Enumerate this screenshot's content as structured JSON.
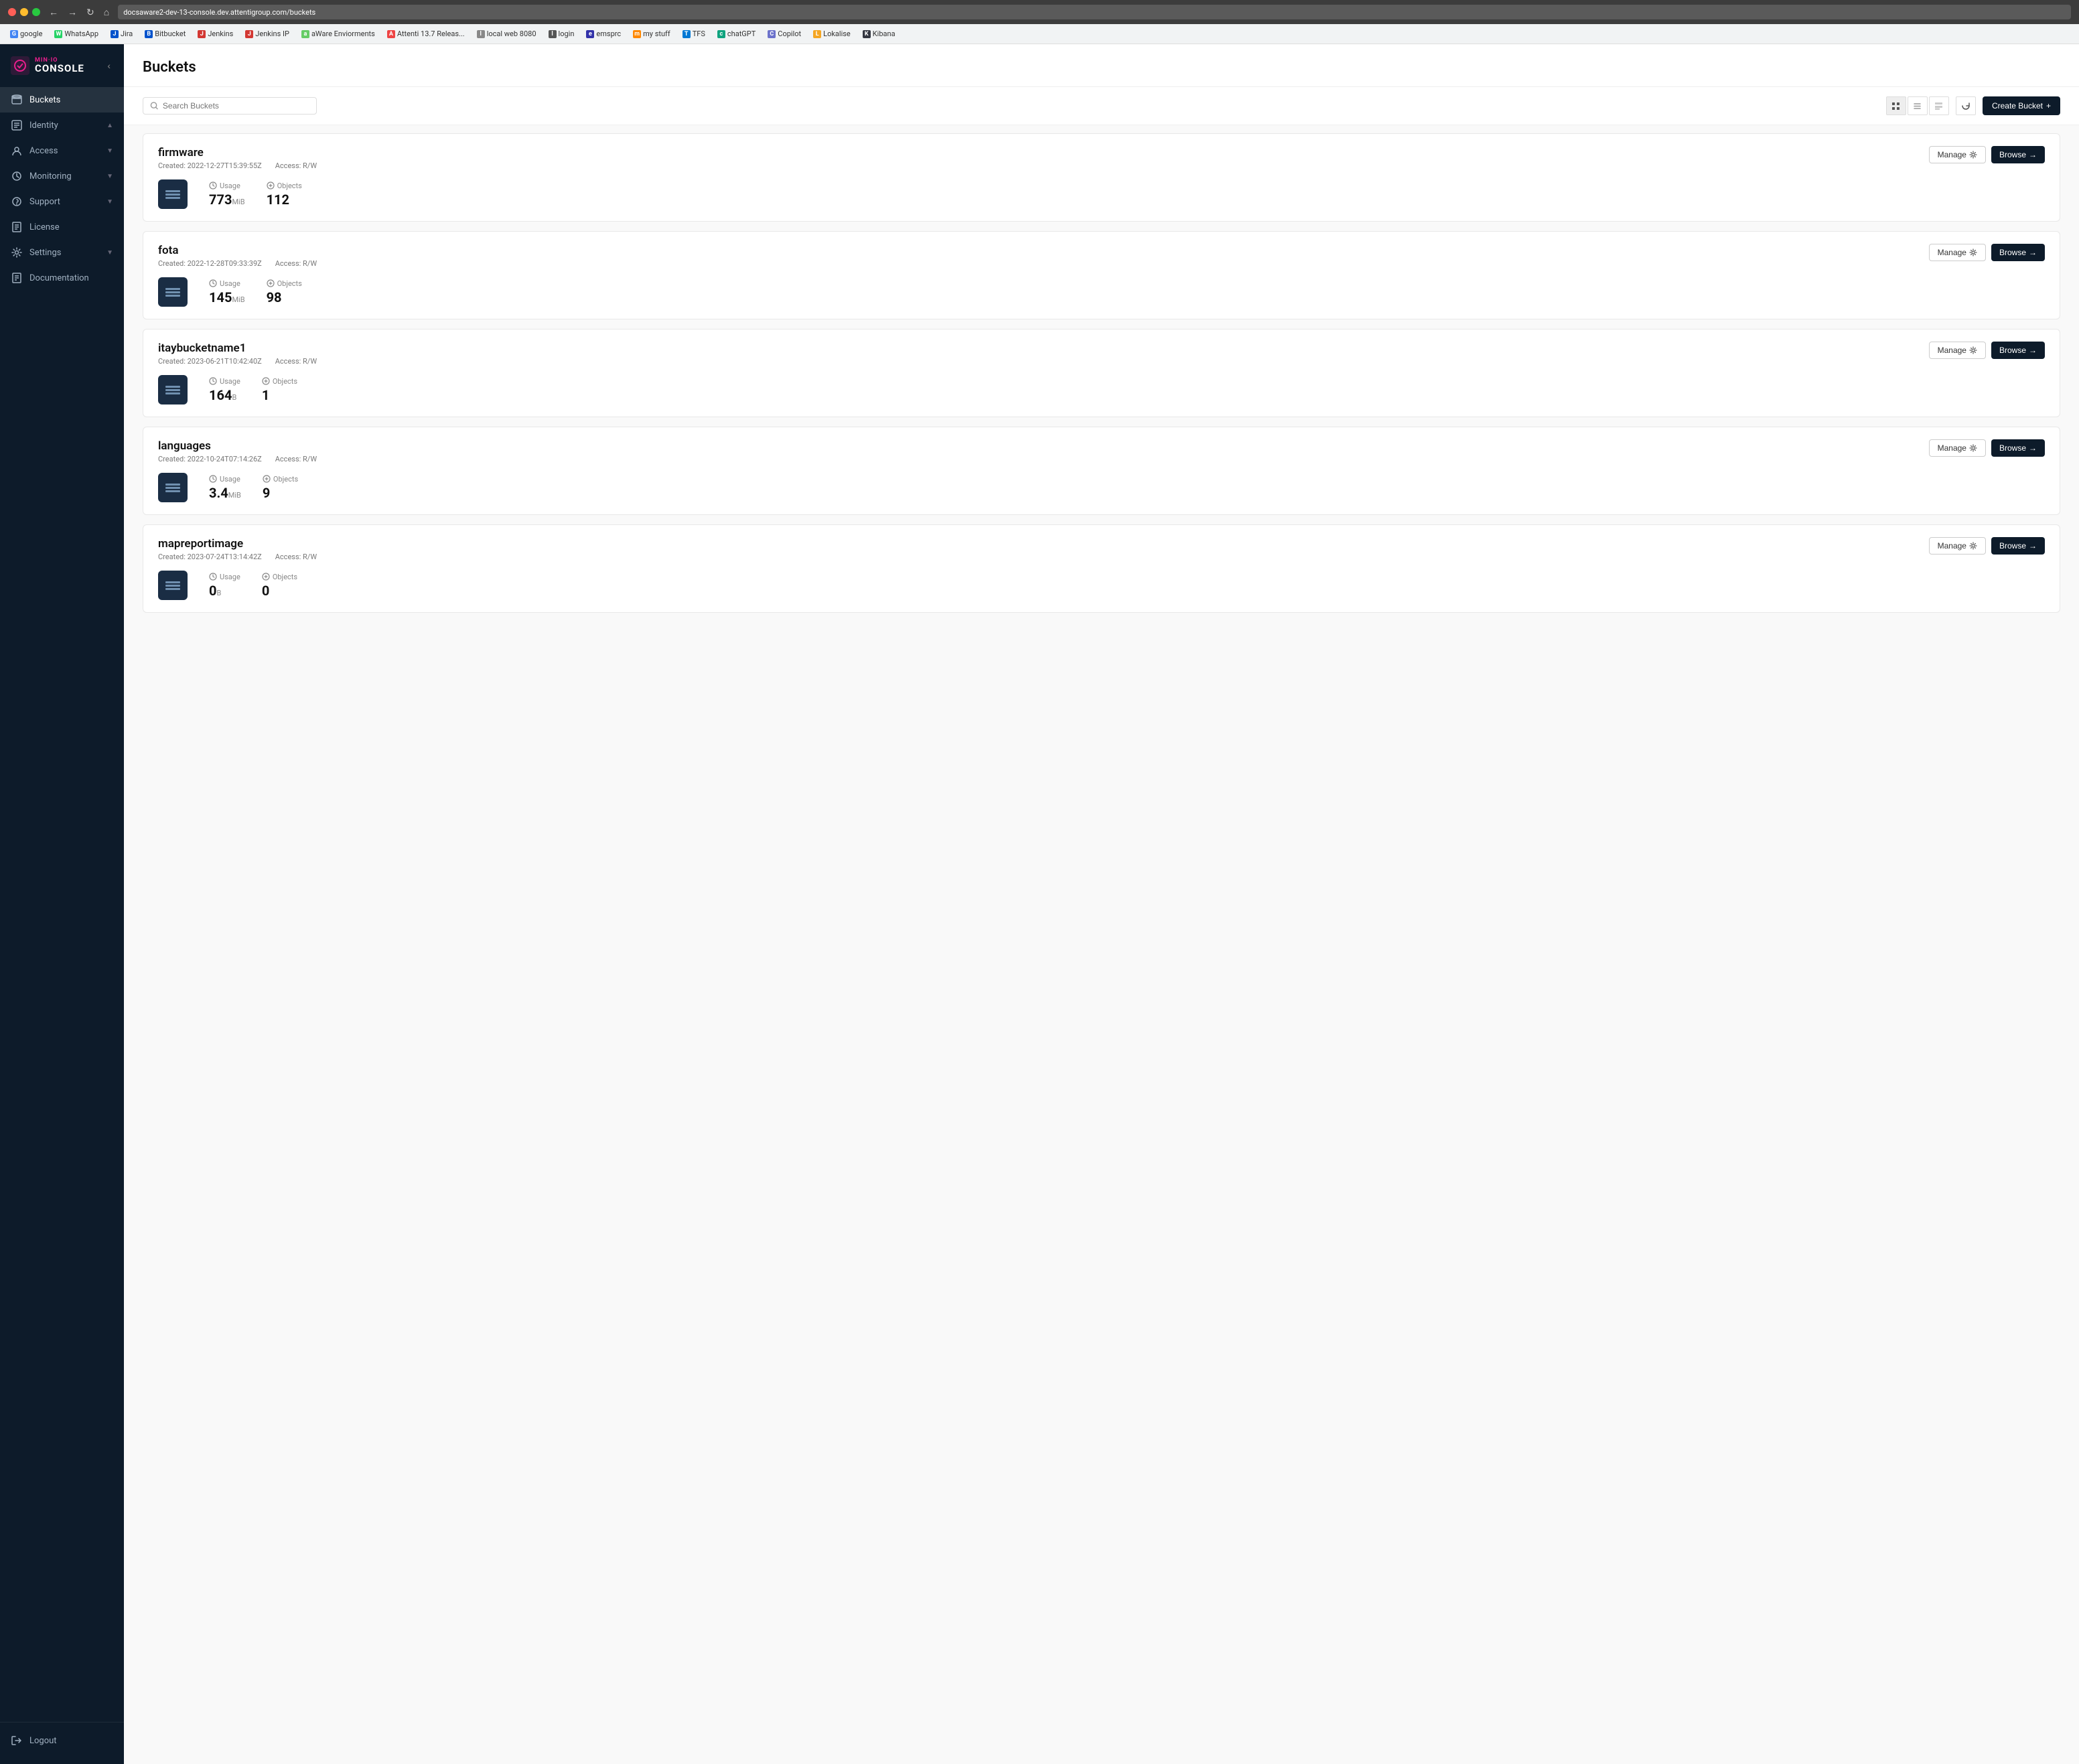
{
  "browser": {
    "url": "docsaware2-dev-13-console.dev.attentigroup.com/buckets",
    "bookmarks": [
      {
        "label": "google",
        "icon": "G"
      },
      {
        "label": "WhatsApp",
        "icon": "W"
      },
      {
        "label": "Jira",
        "icon": "J"
      },
      {
        "label": "Bitbucket",
        "icon": "B"
      },
      {
        "label": "Jenkins",
        "icon": "Je"
      },
      {
        "label": "Jenkins IP",
        "icon": "Ji"
      },
      {
        "label": "aWare Enviorments",
        "icon": "a"
      },
      {
        "label": "Attenti 13.7 Releas...",
        "icon": "A"
      },
      {
        "label": "local web 8080",
        "icon": "l"
      },
      {
        "label": "login",
        "icon": "lo"
      },
      {
        "label": "emsprc",
        "icon": "e"
      },
      {
        "label": "my stuff",
        "icon": "m"
      },
      {
        "label": "TFS",
        "icon": "T"
      },
      {
        "label": "chatGPT",
        "icon": "c"
      },
      {
        "label": "Copilot",
        "icon": "Co"
      },
      {
        "label": "Lokalise",
        "icon": "L"
      },
      {
        "label": "Kibana",
        "icon": "K"
      }
    ]
  },
  "sidebar": {
    "logo_minio": "MIN·IO",
    "logo_console": "CONSOLE",
    "nav_items": [
      {
        "id": "buckets",
        "label": "Buckets",
        "active": true
      },
      {
        "id": "identity",
        "label": "Identity",
        "expandable": true
      },
      {
        "id": "access",
        "label": "Access",
        "expandable": true
      },
      {
        "id": "monitoring",
        "label": "Monitoring",
        "expandable": true
      },
      {
        "id": "support",
        "label": "Support",
        "expandable": true
      },
      {
        "id": "license",
        "label": "License"
      },
      {
        "id": "settings",
        "label": "Settings",
        "expandable": true
      },
      {
        "id": "documentation",
        "label": "Documentation"
      }
    ],
    "logout_label": "Logout"
  },
  "main": {
    "title": "Buckets",
    "search_placeholder": "Search Buckets",
    "create_button": "Create Bucket",
    "buckets": [
      {
        "name": "firmware",
        "created": "Created: 2022-12-27T15:39:55Z",
        "access": "Access: R/W",
        "usage_value": "773",
        "usage_unit": "MiB",
        "objects_value": "112"
      },
      {
        "name": "fota",
        "created": "Created: 2022-12-28T09:33:39Z",
        "access": "Access: R/W",
        "usage_value": "145",
        "usage_unit": "MiB",
        "objects_value": "98"
      },
      {
        "name": "itaybucketname1",
        "created": "Created: 2023-06-21T10:42:40Z",
        "access": "Access: R/W",
        "usage_value": "164",
        "usage_unit": "B",
        "objects_value": "1"
      },
      {
        "name": "languages",
        "created": "Created: 2022-10-24T07:14:26Z",
        "access": "Access: R/W",
        "usage_value": "3.4",
        "usage_unit": "MiB",
        "objects_value": "9"
      },
      {
        "name": "mapreportimage",
        "created": "Created: 2023-07-24T13:14:42Z",
        "access": "Access: R/W",
        "usage_value": "0",
        "usage_unit": "B",
        "objects_value": "0"
      }
    ],
    "manage_label": "Manage",
    "browse_label": "Browse",
    "usage_label": "Usage",
    "objects_label": "Objects"
  }
}
